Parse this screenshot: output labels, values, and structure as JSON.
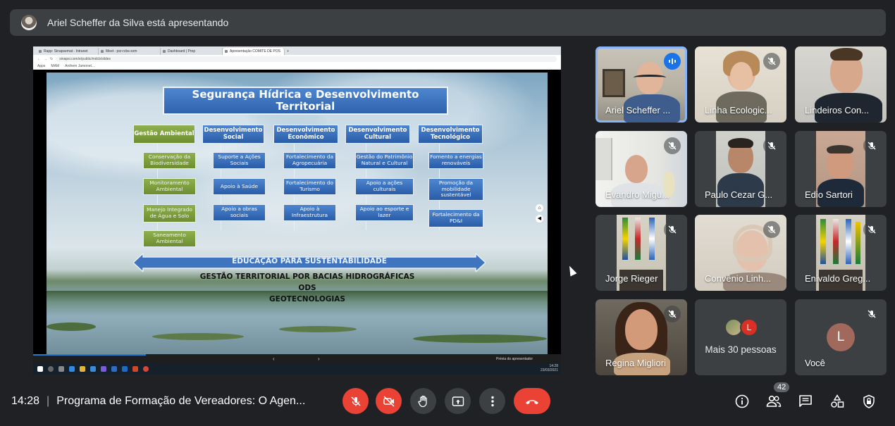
{
  "presenter_banner": {
    "text": "Ariel Scheffer da Silva está apresentando"
  },
  "browser": {
    "tabs": [
      "Rapp: Sinapsemat - Intranet",
      "Meet - psr-rcbs-xvm",
      "Dashboard | Prep",
      "Apresentação COMITE DE POS",
      "+"
    ],
    "url": "sinapsi.com/e/public/mdcb/slides",
    "bookmarks": [
      "Apps",
      "MAM",
      "Anthem Jamonet..."
    ]
  },
  "slide": {
    "title": "Segurança Hídrica e Desenvolvimento Territorial",
    "columns": [
      {
        "header": "Gestão Ambiental",
        "items": [
          "Conservação da Biodiversidade",
          "Monitoramento Ambiental",
          "Manejo Integrado de Água e Solo",
          "Saneamento Ambiental"
        ]
      },
      {
        "header": "Desenvolvimento Social",
        "items": [
          "Suporte a Ações Sociais",
          "Apoio à Saúde",
          "Apoio a obras sociais"
        ]
      },
      {
        "header": "Desenvolvimento Econômico",
        "items": [
          "Fortalecimento da Agropecuária",
          "Fortalecimento do Turismo",
          "Apoio à Infraestrutura"
        ]
      },
      {
        "header": "Desenvolvimento Cultural",
        "items": [
          "Gestão do Patrimônio Natural e Cultural",
          "Apoio a ações culturais",
          "Apoio ao esporte e lazer"
        ]
      },
      {
        "header": "Desenvolvimento Tecnológico",
        "items": [
          "Fomento a energias renováveis",
          "Promoção da mobilidade sustentável",
          "Fortalecimento da PD&I"
        ]
      }
    ],
    "arrow_text": "EDUCAÇÃO PARA SUSTENTABILIDADE",
    "subtitles": [
      "GESTÃO TERRITORIAL POR BACIAS HIDROGRÁFICAS",
      "ODS",
      "GEOTECNOLOGIAS"
    ]
  },
  "ppt_bar": {
    "preview": "Prévia do apresentador",
    "prev": "‹",
    "next": "›"
  },
  "taskbar": {
    "time": "14:28",
    "date": "23/03/2021"
  },
  "participants": [
    {
      "name": "Ariel Scheffer ...",
      "speaking": true
    },
    {
      "name": "Linha Ecologic...",
      "muted": true
    },
    {
      "name": "Lindeiros Con..."
    },
    {
      "name": "Evandro Migu...",
      "muted": true
    },
    {
      "name": "Paulo Cezar G...",
      "muted": true
    },
    {
      "name": "Edio Sartori",
      "muted": true
    },
    {
      "name": "Jorge Rieger",
      "muted": true
    },
    {
      "name": "Convênio Linh...",
      "muted": true
    },
    {
      "name": "Enivaldo Greg...",
      "muted": true
    },
    {
      "name": "Regina Migliori",
      "muted": true
    },
    {
      "name": "Mais 30 pessoas",
      "avatar_letter": "L"
    },
    {
      "name": "Você",
      "avatar_letter": "L",
      "muted": true
    }
  ],
  "bottom": {
    "time": "14:28",
    "separator": "|",
    "meeting_title": "Programa de Formação de Vereadores: O Agen...",
    "people_count": "42"
  },
  "colors": {
    "accent_blue": "#8ab4f8",
    "red": "#ea4335",
    "bg": "#202124",
    "tile": "#3c4043"
  }
}
